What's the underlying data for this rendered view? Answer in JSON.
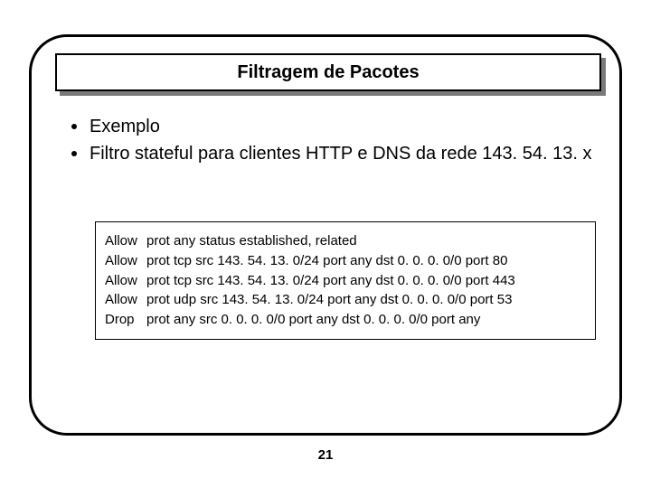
{
  "title": "Filtragem de Pacotes",
  "bullets": [
    "Exemplo",
    "Filtro stateful para clientes HTTP e DNS da rede 143. 54. 13. x"
  ],
  "rules": [
    {
      "action": "Allow",
      "rest": "prot any status established, related"
    },
    {
      "action": "Allow",
      "rest": "prot tcp src 143. 54. 13. 0/24 port any dst 0. 0. 0. 0/0 port 80"
    },
    {
      "action": "Allow",
      "rest": "prot tcp src 143. 54. 13. 0/24 port any dst 0. 0. 0. 0/0 port 443"
    },
    {
      "action": "Allow",
      "rest": "prot udp src 143. 54. 13. 0/24 port any dst 0. 0. 0. 0/0 port 53"
    },
    {
      "action": "Drop",
      "rest": "prot any src 0. 0. 0. 0/0  port any dst 0. 0. 0. 0/0 port any"
    }
  ],
  "page_number": "21"
}
